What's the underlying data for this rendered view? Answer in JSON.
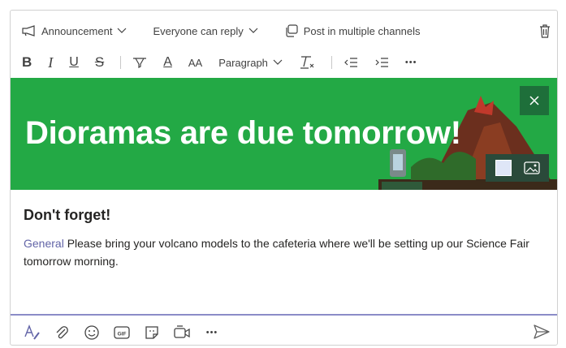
{
  "toolbar": {
    "announcement_label": "Announcement",
    "reply_label": "Everyone can reply",
    "multi_post_label": "Post in multiple channels",
    "paragraph_label": "Paragraph",
    "bold_glyph": "B",
    "italic_glyph": "I",
    "underline_glyph": "U",
    "strike_glyph": "S",
    "font_color_glyph": "A",
    "font_size_glyph": "AA",
    "more_glyph": "•••"
  },
  "banner": {
    "headline": "Dioramas are due tomorrow!",
    "color": "#23a945"
  },
  "message": {
    "subject": "Don't forget!",
    "mention": "General",
    "body": " Please bring your volcano models to the cafeteria where we'll be setting up our Science Fair tomorrow morning."
  },
  "compose": {
    "more_glyph": "•••",
    "accent": "#6264a7"
  },
  "icons": [
    "megaphone-icon",
    "chevron-down-icon",
    "copy-icon",
    "trash-icon",
    "highlight-icon",
    "clear-format-icon",
    "outdent-icon",
    "indent-icon",
    "close-icon",
    "image-icon",
    "format-icon",
    "attach-icon",
    "emoji-icon",
    "gif-icon",
    "sticker-icon",
    "meet-icon",
    "send-icon"
  ]
}
